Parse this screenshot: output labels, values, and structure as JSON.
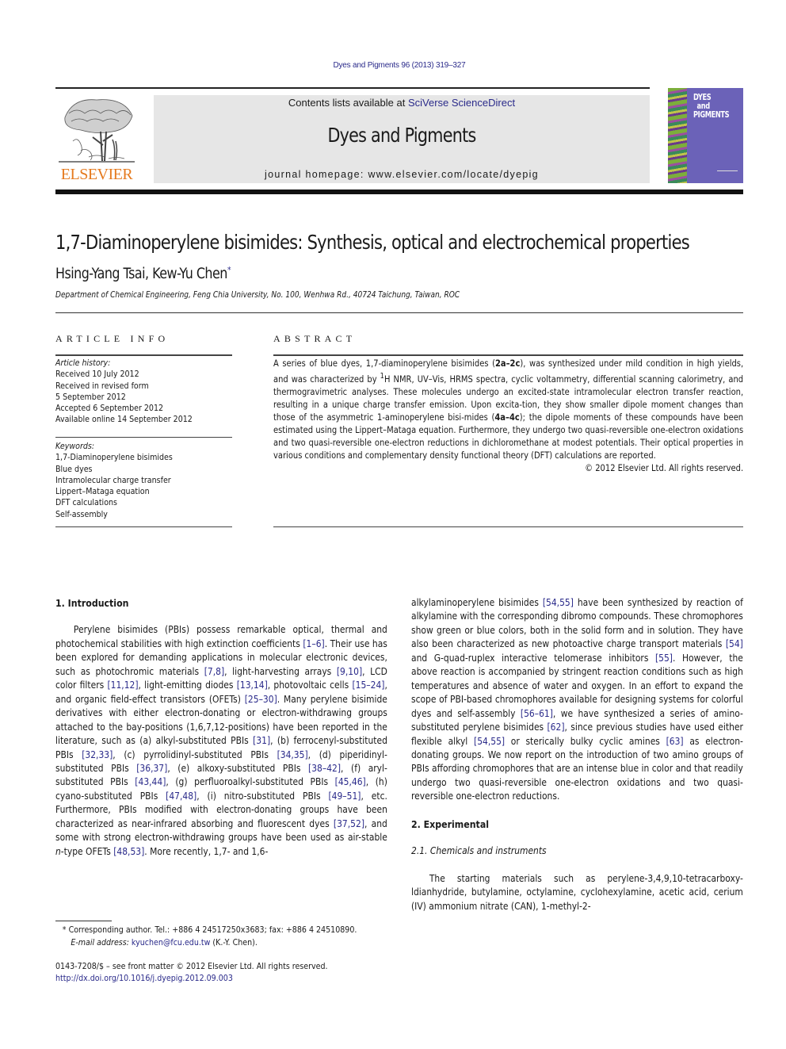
{
  "citation": "Dyes and Pigments 96 (2013) 319–327",
  "header": {
    "publisher_logo_text": "ELSEVIER",
    "contents_prefix": "Contents lists available at ",
    "contents_link": "SciVerse ScienceDirect",
    "journal_name": "Dyes and Pigments",
    "homepage": "journal homepage: www.elsevier.com/locate/dyepig",
    "cover_title_lines": [
      "DYES",
      "and",
      "PIGMENTS"
    ]
  },
  "article": {
    "title": "1,7-Diaminoperylene bisimides: Synthesis, optical and electrochemical properties",
    "authors": "Hsing-Yang Tsai, Kew-Yu Chen",
    "author_mark": "*",
    "affiliation": "Department of Chemical Engineering, Feng Chia University, No. 100, Wenhwa Rd., 40724 Taichung, Taiwan, ROC"
  },
  "article_info": {
    "label": "ARTICLE INFO",
    "history_heading": "Article history:",
    "history": [
      "Received 10 July 2012",
      "Received in revised form",
      "5 September 2012",
      "Accepted 6 September 2012",
      "Available online 14 September 2012"
    ],
    "keywords_heading": "Keywords:",
    "keywords": [
      "1,7-Diaminoperylene bisimides",
      "Blue dyes",
      "Intramolecular charge transfer",
      "Lippert–Mataga equation",
      "DFT calculations",
      "Self-assembly"
    ]
  },
  "abstract": {
    "label": "ABSTRACT",
    "parts": {
      "p1": "A series of blue dyes, 1,7-diaminoperylene bisimides (",
      "b1": "2a–2c",
      "p2": "), was synthesized under mild condition in high yields, and was characterized by ",
      "sup": "1",
      "p3": "H NMR, UV–Vis, HRMS spectra, cyclic voltammetry, differential scanning calorimetry, and thermogravimetric analyses. These molecules undergo an excited-state intramolecular electron transfer reaction, resulting in a unique charge transfer emission. Upon excita-tion, they show smaller dipole moment changes than those of the asymmetric 1-aminoperylene bisi-mides (",
      "b2": "4a–4c",
      "p4": "); the dipole moments of these compounds have been estimated using the Lippert–Mataga equation. Furthermore, they undergo two quasi-reversible one-electron oxidations and two quasi-reversible one-electron reductions in dichloromethane at modest potentials. Their optical properties in various conditions and complementary density functional theory (DFT) calculations are reported."
    },
    "copyright": "© 2012 Elsevier Ltd. All rights reserved."
  },
  "body": {
    "intro_heading": "1.  Introduction",
    "intro": [
      {
        "t": "Perylene bisimides (PBIs) possess remarkable optical, thermal and photochemical stabilities with high extinction coefficients "
      },
      {
        "r": "[1–6]"
      },
      {
        "t": ". Their use has been explored for demanding applications in molecular electronic devices, such as photochromic materials "
      },
      {
        "r": "[7,8]"
      },
      {
        "t": ", light-harvesting arrays "
      },
      {
        "r": "[9,10]"
      },
      {
        "t": ", LCD color filters "
      },
      {
        "r": "[11,12]"
      },
      {
        "t": ", light-emitting diodes "
      },
      {
        "r": "[13,14]"
      },
      {
        "t": ", photovoltaic cells "
      },
      {
        "r": "[15–24]"
      },
      {
        "t": ", and organic field-effect transistors (OFETs) "
      },
      {
        "r": "[25–30]"
      },
      {
        "t": ". Many perylene bisimide derivatives with either electron-donating or electron-withdrawing groups attached to the bay-positions (1,6,7,12-positions) have been reported in the literature, such as (a) alkyl-substituted PBIs "
      },
      {
        "r": "[31]"
      },
      {
        "t": ", (b) ferrocenyl-substituted PBIs "
      },
      {
        "r": "[32,33]"
      },
      {
        "t": ", (c) pyrrolidinyl-substituted PBIs "
      },
      {
        "r": "[34,35]"
      },
      {
        "t": ", (d) piperidinyl-substituted PBIs "
      },
      {
        "r": "[36,37]"
      },
      {
        "t": ", (e) alkoxy-substituted PBIs "
      },
      {
        "r": "[38–42]"
      },
      {
        "t": ", (f) aryl-substituted PBIs "
      },
      {
        "r": "[43,44]"
      },
      {
        "t": ", (g) perfluoroalkyl-substituted PBIs "
      },
      {
        "r": "[45,46]"
      },
      {
        "t": ", (h) cyano-substituted PBIs "
      },
      {
        "r": "[47,48]"
      },
      {
        "t": ", (i) nitro-substituted PBIs "
      },
      {
        "r": "[49–51]"
      },
      {
        "t": ", etc. Furthermore, PBIs modified with electron-donating groups have been characterized as near-infrared absorbing and fluorescent dyes "
      },
      {
        "r": "[37,52]"
      },
      {
        "t": ", and some with strong electron-withdrawing groups have been used as air-stable "
      },
      {
        "i": "n"
      },
      {
        "t": "-type OFETs "
      },
      {
        "r": "[48,53]"
      },
      {
        "t": ". More recently, 1,7- and 1,6-"
      }
    ],
    "intro_cont": [
      {
        "t": "alkylaminoperylene bisimides "
      },
      {
        "r": "[54,55]"
      },
      {
        "t": " have been synthesized by reaction of alkylamine with the corresponding dibromo compounds. These chromophores show green or blue colors, both in the solid form and in solution. They have also been characterized as new photoactive charge transport materials "
      },
      {
        "r": "[54]"
      },
      {
        "t": " and G-quad-ruplex interactive telomerase inhibitors "
      },
      {
        "r": "[55]"
      },
      {
        "t": ". However, the above reaction is accompanied by stringent reaction conditions such as high temperatures and absence of water and oxygen. In an effort to expand the scope of PBI-based chromophores available for designing systems for colorful dyes and self-assembly "
      },
      {
        "r": "[56–61]"
      },
      {
        "t": ", we have synthesized a series of amino-substituted perylene bisimides "
      },
      {
        "r": "[62]"
      },
      {
        "t": ", since previous studies have used either flexible alkyl "
      },
      {
        "r": "[54,55]"
      },
      {
        "t": " or sterically bulky cyclic amines "
      },
      {
        "r": "[63]"
      },
      {
        "t": " as electron-donating groups. We now report on the introduction of two amino groups of PBIs affording chromophores that are an intense blue in color and that readily undergo two quasi-reversible one-electron oxidations and two quasi-reversible one-electron reductions."
      }
    ],
    "exp_heading": "2.  Experimental",
    "exp_sub": "2.1.  Chemicals and instruments",
    "exp_text": "The starting materials such as perylene-3,4,9,10-tetracarboxy-ldianhydride, butylamine, octylamine, cyclohexylamine, acetic acid, cerium (IV) ammonium nitrate (CAN), 1-methyl-2-"
  },
  "footnotes": {
    "corresponding": "*  Corresponding author. Tel.: +886 4 24517250x3683; fax: +886 4 24510890.",
    "email_label": "E-mail address: ",
    "email": "kyuchen@fcu.edu.tw",
    "email_suffix": " (K.-Y. Chen).",
    "front_matter": "0143-7208/$ – see front matter © 2012 Elsevier Ltd. All rights reserved.",
    "doi": "http://dx.doi.org/10.1016/j.dyepig.2012.09.003"
  },
  "colors": {
    "link": "#2a2a8a",
    "elsevier_orange": "#e57a1e",
    "banner_gray": "#e6e6e6",
    "cover_purple": "#6b62b8"
  }
}
